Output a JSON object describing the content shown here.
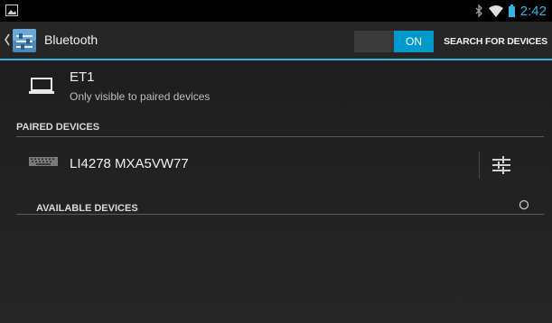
{
  "status_bar": {
    "time": "2:42",
    "icons": [
      "gallery-icon",
      "bluetooth-icon",
      "wifi-icon",
      "battery-icon"
    ],
    "accent_color": "#33b5e5"
  },
  "action_bar": {
    "title": "Bluetooth",
    "toggle_label": "ON",
    "search_label": "SEARCH FOR DEVICES",
    "accent_color": "#0099cc"
  },
  "this_device": {
    "name": "ET1",
    "visibility": "Only visible to paired devices",
    "icon": "laptop-icon"
  },
  "paired_section": {
    "header": "PAIRED DEVICES",
    "devices": [
      {
        "name": "LI4278 MXA5VW77",
        "icon": "keyboard-icon"
      }
    ]
  },
  "available_section": {
    "header": "AVAILABLE DEVICES"
  }
}
